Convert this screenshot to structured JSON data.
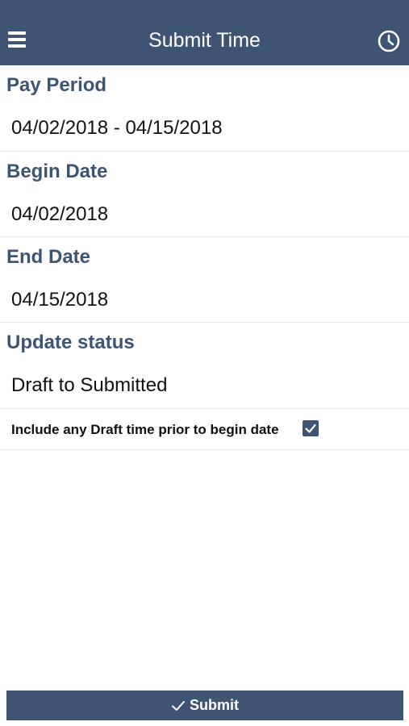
{
  "header": {
    "title": "Submit Time",
    "menu_icon": "hamburger-menu-icon",
    "history_icon": "clock-icon",
    "background": "#3d5573"
  },
  "fields": {
    "pay_period": {
      "label": "Pay Period",
      "value": "04/02/2018 - 04/15/2018"
    },
    "begin_date": {
      "label": "Begin Date",
      "value": "04/02/2018"
    },
    "end_date": {
      "label": "End Date",
      "value": "04/15/2018"
    },
    "update_status": {
      "label": "Update status",
      "value": "Draft to Submitted"
    }
  },
  "include_draft": {
    "label": "Include any Draft time prior to begin date",
    "checked": true
  },
  "submit": {
    "label": "Submit",
    "icon": "checkmark-icon"
  },
  "colors": {
    "accent": "#3d5573",
    "label_text": "#3d5573",
    "divider": "#e6e6e6"
  }
}
